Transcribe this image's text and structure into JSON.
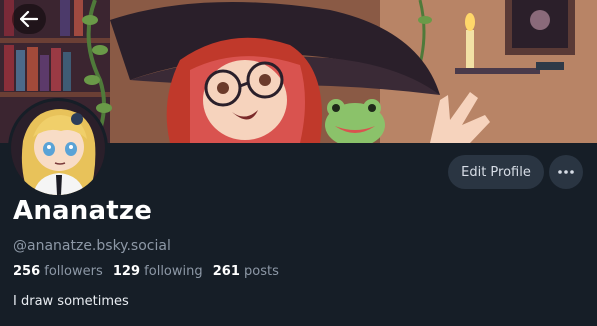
{
  "profile": {
    "display_name": "Ananatze",
    "handle": "@ananatze.bsky.social",
    "bio": "I draw sometimes",
    "stats": {
      "followers_count": "256",
      "followers_label": "followers",
      "following_count": "129",
      "following_label": "following",
      "posts_count": "261",
      "posts_label": "posts"
    }
  },
  "actions": {
    "edit_profile_label": "Edit Profile"
  },
  "icons": {
    "back": "arrow-left-icon",
    "more": "more-horizontal-icon"
  },
  "colors": {
    "background": "#161e27",
    "button_bg": "#2a3542",
    "muted_text": "#8d98a6",
    "primary_text": "#ffffff"
  }
}
